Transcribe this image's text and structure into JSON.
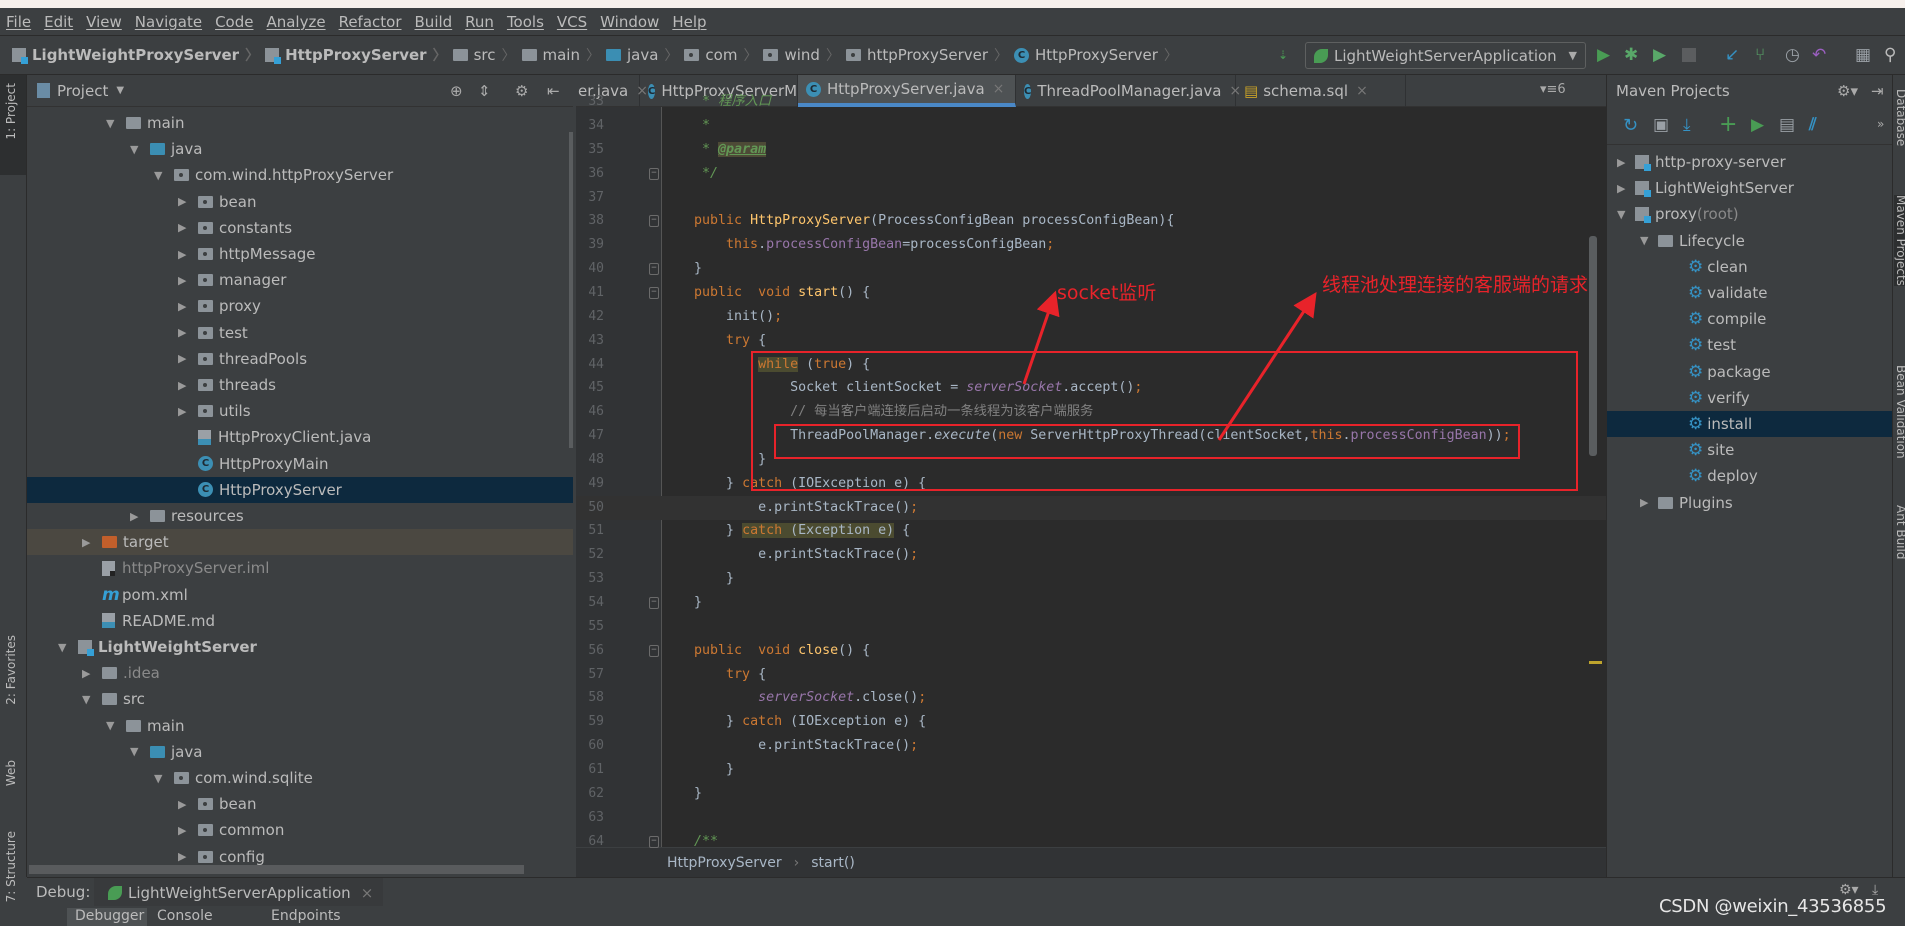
{
  "menu": [
    "File",
    "Edit",
    "View",
    "Navigate",
    "Code",
    "Analyze",
    "Refactor",
    "Build",
    "Run",
    "Tools",
    "VCS",
    "Window",
    "Help"
  ],
  "breadcrumb": [
    {
      "label": "LightWeightProxyServer",
      "icon": "module-icon",
      "bold": true
    },
    {
      "label": "HttpProxyServer",
      "icon": "module-icon",
      "bold": true
    },
    {
      "label": "src",
      "icon": "folder-icon"
    },
    {
      "label": "main",
      "icon": "folder-icon"
    },
    {
      "label": "java",
      "icon": "source-folder-icon"
    },
    {
      "label": "com",
      "icon": "package-icon"
    },
    {
      "label": "wind",
      "icon": "package-icon"
    },
    {
      "label": "httpProxyServer",
      "icon": "package-icon"
    },
    {
      "label": "HttpProxyServer",
      "icon": "class-icon"
    }
  ],
  "run_config": {
    "label": "LightWeightServerApplication"
  },
  "left_stripe": {
    "project": "1: Project",
    "favorites": "2: Favorites",
    "web": "Web",
    "structure": "7: Structure"
  },
  "right_stripe": {
    "database": "Database",
    "maven": "Maven Projects",
    "bean": "Bean Validation",
    "ant": "Ant Build"
  },
  "project_panel": {
    "title": "Project",
    "items": [
      {
        "label": "main",
        "depth": 2,
        "state": "open",
        "icon": "folder"
      },
      {
        "label": "java",
        "depth": 3,
        "state": "open",
        "icon": "folder-blue"
      },
      {
        "label": "com.wind.httpProxyServer",
        "depth": 4,
        "state": "open",
        "icon": "package"
      },
      {
        "label": "bean",
        "depth": 5,
        "state": "closed",
        "icon": "package"
      },
      {
        "label": "constants",
        "depth": 5,
        "state": "closed",
        "icon": "package"
      },
      {
        "label": "httpMessage",
        "depth": 5,
        "state": "closed",
        "icon": "package"
      },
      {
        "label": "manager",
        "depth": 5,
        "state": "closed",
        "icon": "package"
      },
      {
        "label": "proxy",
        "depth": 5,
        "state": "closed",
        "icon": "package"
      },
      {
        "label": "test",
        "depth": 5,
        "state": "closed",
        "icon": "package"
      },
      {
        "label": "threadPools",
        "depth": 5,
        "state": "closed",
        "icon": "package"
      },
      {
        "label": "threads",
        "depth": 5,
        "state": "closed",
        "icon": "package"
      },
      {
        "label": "utils",
        "depth": 5,
        "state": "closed",
        "icon": "package"
      },
      {
        "label": "HttpProxyClient.java",
        "depth": 5,
        "state": "leaf",
        "icon": "java-file"
      },
      {
        "label": "HttpProxyMain",
        "depth": 5,
        "state": "leaf",
        "icon": "class"
      },
      {
        "label": "HttpProxyServer",
        "depth": 5,
        "state": "leaf",
        "icon": "class",
        "selected": true
      },
      {
        "label": "resources",
        "depth": 3,
        "state": "closed",
        "icon": "folder"
      },
      {
        "label": "target",
        "depth": 1,
        "state": "closed",
        "icon": "folder-orange",
        "excluded": true
      },
      {
        "label": "httpProxyServer.iml",
        "depth": 1,
        "state": "leaf",
        "icon": "iml-file",
        "dim": true
      },
      {
        "label": "pom.xml",
        "depth": 1,
        "state": "leaf",
        "icon": "maven"
      },
      {
        "label": "README.md",
        "depth": 1,
        "state": "leaf",
        "icon": "md-file"
      },
      {
        "label": "LightWeightServer",
        "depth": 0,
        "state": "open",
        "icon": "module",
        "bold": true
      },
      {
        "label": ".idea",
        "depth": 1,
        "state": "closed",
        "icon": "folder",
        "dim": true
      },
      {
        "label": "src",
        "depth": 1,
        "state": "open",
        "icon": "folder"
      },
      {
        "label": "main",
        "depth": 2,
        "state": "open",
        "icon": "folder"
      },
      {
        "label": "java",
        "depth": 3,
        "state": "open",
        "icon": "folder-blue"
      },
      {
        "label": "com.wind.sqlite",
        "depth": 4,
        "state": "open",
        "icon": "package"
      },
      {
        "label": "bean",
        "depth": 5,
        "state": "closed",
        "icon": "package"
      },
      {
        "label": "common",
        "depth": 5,
        "state": "closed",
        "icon": "package"
      },
      {
        "label": "config",
        "depth": 5,
        "state": "closed",
        "icon": "package"
      }
    ]
  },
  "editor": {
    "tabs": [
      {
        "label": "er.java",
        "icon": "none"
      },
      {
        "label": "HttpProxyServerManager.java",
        "icon": "class"
      },
      {
        "label": "HttpProxyServer.java",
        "icon": "class",
        "active": true
      },
      {
        "label": "ThreadPoolManager.java",
        "icon": "class"
      },
      {
        "label": "schema.sql",
        "icon": "sql"
      }
    ],
    "tab_overflow": "6",
    "current_line": 50,
    "lines": [
      {
        "n": 33,
        "s": [
          [
            "doc",
            "     * 程序入口"
          ]
        ]
      },
      {
        "n": 34,
        "s": [
          [
            "doc",
            "     *"
          ]
        ]
      },
      {
        "n": 35,
        "s": [
          [
            "doc",
            "     * "
          ],
          [
            "tag",
            "@param"
          ]
        ]
      },
      {
        "n": 36,
        "s": [
          [
            "doc",
            "     */"
          ]
        ]
      },
      {
        "n": 37,
        "s": []
      },
      {
        "n": 38,
        "s": [
          [
            "kw",
            "    public "
          ],
          [
            "fn",
            "HttpProxyServer"
          ],
          [
            "plain",
            "(ProcessConfigBean processConfigBean){"
          ]
        ]
      },
      {
        "n": 39,
        "s": [
          [
            "kw",
            "        this"
          ],
          [
            "plain",
            "."
          ],
          [
            "fld",
            "processConfigBean"
          ],
          [
            "plain",
            "=processConfigBean"
          ],
          [
            "kw",
            ";"
          ]
        ]
      },
      {
        "n": 40,
        "s": [
          [
            "plain",
            "    }"
          ]
        ]
      },
      {
        "n": 41,
        "s": [
          [
            "kw",
            "    public  void "
          ],
          [
            "fn",
            "start"
          ],
          [
            "plain",
            "() {"
          ]
        ]
      },
      {
        "n": 42,
        "s": [
          [
            "plain",
            "        init()"
          ],
          [
            "kw",
            ";"
          ]
        ]
      },
      {
        "n": 43,
        "s": [
          [
            "kw",
            "        try"
          ],
          [
            "plain",
            " {"
          ]
        ]
      },
      {
        "n": 44,
        "s": [
          [
            "plain",
            "            "
          ],
          [
            "kwhl",
            "while"
          ],
          [
            "plain",
            " ("
          ],
          [
            "kw",
            "true"
          ],
          [
            "plain",
            ") {"
          ]
        ]
      },
      {
        "n": 45,
        "s": [
          [
            "plain",
            "                Socket clientSocket = "
          ],
          [
            "itfld",
            "serverSocket"
          ],
          [
            "plain",
            ".accept()"
          ],
          [
            "kw",
            ";"
          ]
        ]
      },
      {
        "n": 46,
        "s": [
          [
            "cm",
            "                // 每当客户端连接后启动一条线程为该客户端服务"
          ]
        ]
      },
      {
        "n": 47,
        "s": [
          [
            "plain",
            "                ThreadPoolManager."
          ],
          [
            "it",
            "execute"
          ],
          [
            "plain",
            "("
          ],
          [
            "kw",
            "new"
          ],
          [
            "plain",
            " ServerHttpProxyThread(clientSocket,"
          ],
          [
            "kw",
            "this"
          ],
          [
            "plain",
            "."
          ],
          [
            "fld",
            "processConfigBean"
          ],
          [
            "plain",
            "))"
          ],
          [
            "kw",
            ";"
          ]
        ]
      },
      {
        "n": 48,
        "s": [
          [
            "plain",
            "            }"
          ]
        ]
      },
      {
        "n": 49,
        "s": [
          [
            "plain",
            "        } "
          ],
          [
            "kw",
            "catch"
          ],
          [
            "plain",
            " (IOException e) {"
          ]
        ]
      },
      {
        "n": 50,
        "s": [
          [
            "plain",
            "            e.printStackTrace()"
          ],
          [
            "kw",
            ";"
          ]
        ]
      },
      {
        "n": 51,
        "s": [
          [
            "plain",
            "        } "
          ],
          [
            "kwhl",
            "catch"
          ],
          [
            "hl",
            " (Exception e)"
          ],
          [
            "plain",
            " {"
          ]
        ]
      },
      {
        "n": 52,
        "s": [
          [
            "plain",
            "            e.printStackTrace()"
          ],
          [
            "kw",
            ";"
          ]
        ]
      },
      {
        "n": 53,
        "s": [
          [
            "plain",
            "        }"
          ]
        ]
      },
      {
        "n": 54,
        "s": [
          [
            "plain",
            "    }"
          ]
        ]
      },
      {
        "n": 55,
        "s": []
      },
      {
        "n": 56,
        "s": [
          [
            "kw",
            "    public  void "
          ],
          [
            "fn",
            "close"
          ],
          [
            "plain",
            "() {"
          ]
        ]
      },
      {
        "n": 57,
        "s": [
          [
            "kw",
            "        try"
          ],
          [
            "plain",
            " {"
          ]
        ]
      },
      {
        "n": 58,
        "s": [
          [
            "plain",
            "            "
          ],
          [
            "itfld",
            "serverSocket"
          ],
          [
            "plain",
            ".close()"
          ],
          [
            "kw",
            ";"
          ]
        ]
      },
      {
        "n": 59,
        "s": [
          [
            "plain",
            "        } "
          ],
          [
            "kw",
            "catch"
          ],
          [
            "plain",
            " (IOException e) {"
          ]
        ]
      },
      {
        "n": 60,
        "s": [
          [
            "plain",
            "            e.printStackTrace()"
          ],
          [
            "kw",
            ";"
          ]
        ]
      },
      {
        "n": 61,
        "s": [
          [
            "plain",
            "        }"
          ]
        ]
      },
      {
        "n": 62,
        "s": [
          [
            "plain",
            "    }"
          ]
        ]
      },
      {
        "n": 63,
        "s": []
      },
      {
        "n": 64,
        "s": [
          [
            "doc",
            "    /**"
          ]
        ]
      }
    ],
    "breadcrumb": [
      "HttpProxyServer",
      "start()"
    ]
  },
  "annotations": {
    "socket": "socket监听",
    "threadpool": "线程池处理连接的客服端的请求",
    "color": "#e8232a"
  },
  "maven": {
    "title": "Maven Projects",
    "items": [
      {
        "label": "http-proxy-server",
        "level": 0,
        "state": "closed",
        "icon": "maven-module"
      },
      {
        "label": "LightWeightServer",
        "level": 0,
        "state": "closed",
        "icon": "maven-module"
      },
      {
        "label": "proxy",
        "suffix": " (root)",
        "level": 0,
        "state": "open",
        "icon": "maven-module"
      },
      {
        "label": "Lifecycle",
        "level": 1,
        "state": "open",
        "icon": "lifecycle-folder"
      },
      {
        "label": "clean",
        "level": 2,
        "state": "leaf",
        "icon": "gear"
      },
      {
        "label": "validate",
        "level": 2,
        "state": "leaf",
        "icon": "gear"
      },
      {
        "label": "compile",
        "level": 2,
        "state": "leaf",
        "icon": "gear"
      },
      {
        "label": "test",
        "level": 2,
        "state": "leaf",
        "icon": "gear"
      },
      {
        "label": "package",
        "level": 2,
        "state": "leaf",
        "icon": "gear"
      },
      {
        "label": "verify",
        "level": 2,
        "state": "leaf",
        "icon": "gear"
      },
      {
        "label": "install",
        "level": 2,
        "state": "leaf",
        "icon": "gear",
        "selected": true
      },
      {
        "label": "site",
        "level": 2,
        "state": "leaf",
        "icon": "gear"
      },
      {
        "label": "deploy",
        "level": 2,
        "state": "leaf",
        "icon": "gear"
      },
      {
        "label": "Plugins",
        "level": 1,
        "state": "closed",
        "icon": "lifecycle-folder"
      }
    ]
  },
  "debug": {
    "label": "Debug:",
    "tab": "LightWeightServerApplication",
    "subtabs": [
      "Debugger",
      "Console",
      "Endpoints"
    ]
  },
  "watermark": "CSDN @weixin_43536855"
}
